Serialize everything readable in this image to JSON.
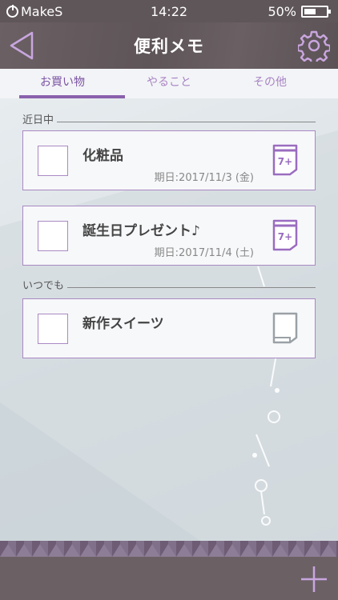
{
  "status_bar": {
    "carrier": "MakeS",
    "time": "14:22",
    "battery": "50%"
  },
  "header": {
    "title": "便利メモ",
    "back_icon": "back-triangle-icon",
    "settings_icon": "gear-icon"
  },
  "tabs": [
    {
      "label": "お買い物",
      "active": true
    },
    {
      "label": "やること",
      "active": false
    },
    {
      "label": "その他",
      "active": false
    }
  ],
  "sections": [
    {
      "label": "近日中",
      "items": [
        {
          "name": "化粧品",
          "due": "期日:2017/11/3 (金)",
          "icon": "calendar-7plus-icon"
        },
        {
          "name": "誕生日プレゼント♪",
          "due": "期日:2017/11/4 (土)",
          "icon": "calendar-7plus-icon"
        }
      ]
    },
    {
      "label": "いつでも",
      "items": [
        {
          "name": "新作スイーツ",
          "icon": "blank-note-icon"
        }
      ]
    }
  ],
  "calendar_badge": "7+",
  "footer": {
    "add_icon": "plus-icon"
  },
  "colors": {
    "accent": "#8a60ac",
    "header": "#5f5659",
    "card_border": "#a988c2"
  }
}
